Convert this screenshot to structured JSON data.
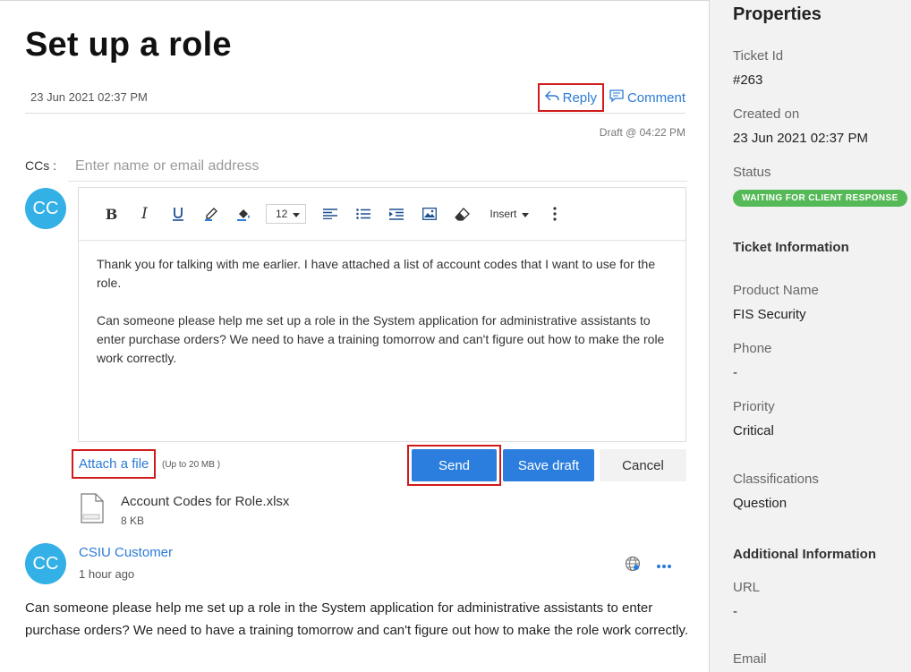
{
  "ticket": {
    "title": "Set up a role",
    "date": "23 Jun 2021 02:37 PM",
    "reply_label": "Reply",
    "comment_label": "Comment",
    "draft_time": "Draft @ 04:22 PM"
  },
  "composer": {
    "ccs_label": "CCs :",
    "ccs_placeholder": "Enter name or email address",
    "avatar_initials": "CC",
    "font_size": "12",
    "insert_label": "Insert",
    "body_paragraphs": [
      "Thank you for talking with me earlier. I have attached a list of account codes that I want to use for the role.",
      "Can someone please help me set up a role in the System application for administrative assistants to enter purchase orders? We need to have a training tomorrow and can't figure out how to make the role work correctly."
    ],
    "attach_label": "Attach a file",
    "attach_note": "(Up to 20 MB )",
    "send_label": "Send",
    "save_draft_label": "Save draft",
    "cancel_label": "Cancel"
  },
  "attachment": {
    "name": "Account Codes for Role.xlsx",
    "size": "8 KB"
  },
  "conversation": {
    "avatar_initials": "CC",
    "author": "CSIU Customer",
    "time": "1 hour ago",
    "body": "Can someone please help me set up a role in the System application for administrative assistants to enter purchase orders? We need to have a training tomorrow and can't figure out how to make the role work correctly."
  },
  "properties": {
    "title": "Properties",
    "ticket_id_label": "Ticket Id",
    "ticket_id": "#263",
    "created_label": "Created on",
    "created": "23 Jun 2021 02:37 PM",
    "status_label": "Status",
    "status": "WAITING FOR CLIENT RESPONSE",
    "ticket_info_heading": "Ticket Information",
    "product_label": "Product Name",
    "product": "FIS Security",
    "phone_label": "Phone",
    "phone": "-",
    "priority_label": "Priority",
    "priority": "Critical",
    "class_label": "Classifications",
    "classification": "Question",
    "additional_heading": "Additional Information",
    "url_label": "URL",
    "url": "-",
    "email_label": "Email"
  },
  "colors": {
    "accent": "#2b7ede",
    "link": "#2b7bd6",
    "highlight": "#d11a1a",
    "status_green": "#56b957",
    "avatar": "#33b0e6"
  }
}
